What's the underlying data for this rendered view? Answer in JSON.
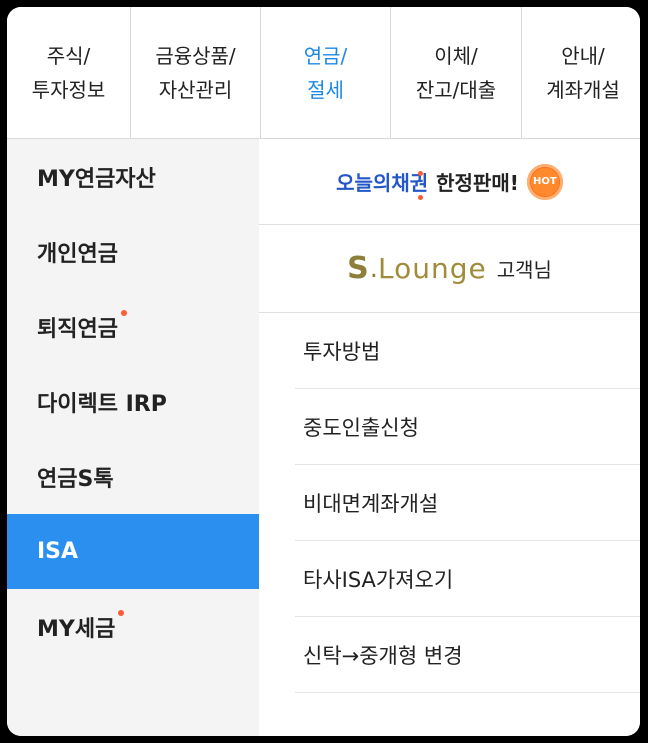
{
  "tabs": [
    {
      "line1": "주식/",
      "line2": "투자정보"
    },
    {
      "line1": "금융상품/",
      "line2": "자산관리"
    },
    {
      "line1": "연금/",
      "line2": "절세"
    },
    {
      "line1": "이체/",
      "line2": "잔고/대출"
    },
    {
      "line1": "안내/",
      "line2": "계좌개설"
    }
  ],
  "active_tab": 2,
  "sidebar": {
    "items": [
      {
        "label": "MY연금자산"
      },
      {
        "label": "개인연금"
      },
      {
        "label": "퇴직연금"
      },
      {
        "label": "다이렉트 IRP"
      },
      {
        "label": "연금S톡"
      },
      {
        "label": "ISA"
      },
      {
        "label": "MY세금"
      }
    ],
    "active_index": 5
  },
  "promo": {
    "highlight": "오늘의채권",
    "text": "한정판매!",
    "badge": "HOT"
  },
  "lounge": {
    "logo_s": "S",
    "logo_dot": ".",
    "logo_word": "Lounge",
    "suffix": "고객님"
  },
  "menu": {
    "items": [
      {
        "label": "투자방법"
      },
      {
        "label": "중도인출신청"
      },
      {
        "label": "비대면계좌개설"
      },
      {
        "label": "타사ISA가져오기"
      },
      {
        "label": "신탁→중개형 변경"
      }
    ]
  },
  "colors": {
    "accent": "#2b8ff0",
    "active_tab_text": "#1e88e5",
    "dot": "#ff5a36",
    "lounge_gold": "#a08d3b"
  }
}
